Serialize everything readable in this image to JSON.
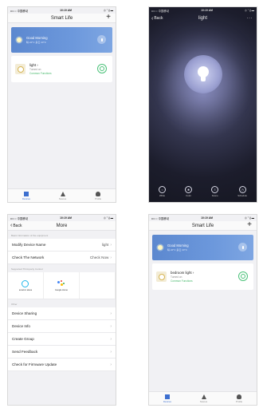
{
  "status": {
    "carrier": "•••○○ 中国移动",
    "time": "10:19 AM",
    "right": "◎ ⁷ ∦ ▬"
  },
  "home": {
    "title": "Smart Life",
    "add_symbol": "+",
    "weather": {
      "greeting": "Good Morning",
      "detail": "晴 22°C  多云  23°C"
    },
    "device": {
      "name": "light",
      "state": "Turned on",
      "functions": "Common Functions"
    },
    "tabs": [
      {
        "label": "Devices"
      },
      {
        "label": "Scenes"
      },
      {
        "label": "Profile"
      }
    ]
  },
  "light": {
    "back": "Back",
    "title": "light",
    "more": "···",
    "controls": [
      {
        "label": "White",
        "icon": "power-ring-icon"
      },
      {
        "label": "Color",
        "icon": "palette-icon"
      },
      {
        "label": "Scene",
        "icon": "list-icon"
      },
      {
        "label": "Schedule",
        "icon": "clock-icon"
      }
    ]
  },
  "more": {
    "back": "Back",
    "title": "More",
    "section_basic": "Basic information of the equipment",
    "rows_basic": [
      {
        "label": "Modify Device Name",
        "value": "light"
      },
      {
        "label": "Check The Network",
        "value": "Check Now"
      }
    ],
    "section_third": "Supported Third-party Control",
    "third": [
      {
        "label": "amazon alexa"
      },
      {
        "label": "Google Home"
      }
    ],
    "section_other": "Other",
    "rows_other": [
      {
        "label": "Device Sharing"
      },
      {
        "label": "Device Info"
      },
      {
        "label": "Create Group"
      },
      {
        "label": "Send Feedback"
      },
      {
        "label": "Check for Firmware Update"
      }
    ]
  },
  "home2": {
    "title": "Smart Life",
    "add_symbol": "+",
    "weather": {
      "greeting": "Good Morning",
      "detail": "晴 22°C  多云  23°C"
    },
    "device": {
      "name": "bedroom light",
      "state": "Turned on",
      "functions": "Common Functions"
    },
    "tabs": [
      {
        "label": "Devices"
      },
      {
        "label": "Scenes"
      },
      {
        "label": "Profile"
      }
    ]
  }
}
